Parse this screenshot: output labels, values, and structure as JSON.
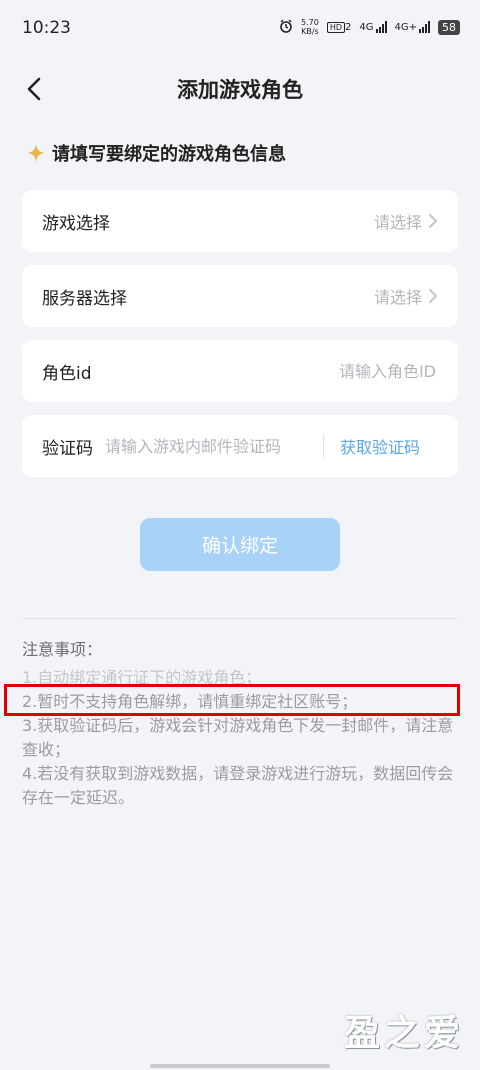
{
  "status_bar": {
    "time": "10:23",
    "net_speed_value": "5.70",
    "net_speed_unit": "KB/s",
    "hd_label": "HD",
    "hd_sub": "2",
    "sig1_label": "4G",
    "sig2_label": "4G+",
    "battery": "58"
  },
  "header": {
    "title": "添加游戏角色"
  },
  "section": {
    "title": "请填写要绑定的游戏角色信息"
  },
  "form": {
    "game_label": "游戏选择",
    "game_value": "请选择",
    "server_label": "服务器选择",
    "server_value": "请选择",
    "role_label": "角色id",
    "role_placeholder": "请输入角色ID",
    "code_label": "验证码",
    "code_placeholder": "请输入游戏内邮件验证码",
    "get_code": "获取验证码"
  },
  "confirm_label": "确认绑定",
  "notes": {
    "title": "注意事项：",
    "items": [
      "1.自动绑定通行证下的游戏角色；",
      "2.暂时不支持角色解绑，请慎重绑定社区账号；",
      "3.获取验证码后，游戏会针对游戏角色下发一封邮件，请注意查收；",
      "4.若没有获取到游戏数据，请登录游戏进行游玩，数据回传会存在一定延迟。"
    ]
  },
  "watermark": "盈之爱",
  "colors": {
    "accent": "#58a7ef",
    "button": "#a8d2f7",
    "highlight": "#e00000",
    "star": "#e8b64c"
  }
}
